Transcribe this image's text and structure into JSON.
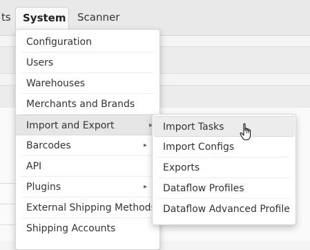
{
  "nav": {
    "partial_tab": "ts",
    "system_tab": "System",
    "scanner_tab": "Scanner"
  },
  "system_menu": {
    "items": [
      {
        "label": "Configuration"
      },
      {
        "label": "Users"
      },
      {
        "label": "Warehouses"
      },
      {
        "label": "Merchants and Brands"
      },
      {
        "label": "Import and Export",
        "submenu": true,
        "active": true
      },
      {
        "label": "Barcodes",
        "submenu": true
      },
      {
        "label": "API"
      },
      {
        "label": "Plugins",
        "submenu": true
      },
      {
        "label": "External Shipping Methods"
      },
      {
        "label": "Shipping Accounts"
      }
    ],
    "arrow_glyph": "▸"
  },
  "import_export_submenu": {
    "items": [
      {
        "label": "Import Tasks",
        "hovered": true
      },
      {
        "label": "Import Configs"
      },
      {
        "label": "Exports"
      },
      {
        "label": "Dataflow Profiles"
      },
      {
        "label": "Dataflow Advanced Profiles"
      }
    ]
  },
  "cursor_icon": "hand-pointer-icon"
}
